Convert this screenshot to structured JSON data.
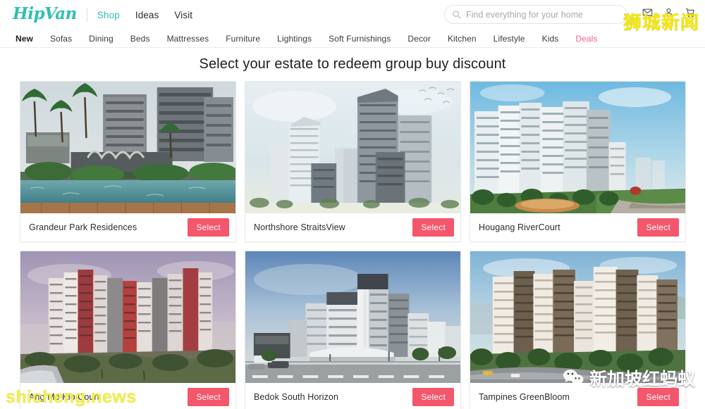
{
  "header": {
    "brand": "HipVan",
    "primary_nav": [
      {
        "label": "Shop",
        "active": true
      },
      {
        "label": "Ideas",
        "active": false
      },
      {
        "label": "Visit",
        "active": false
      }
    ],
    "search": {
      "placeholder": "Find everything for your home",
      "value": "",
      "icon": "search-icon"
    },
    "icons": [
      {
        "name": "mail-icon"
      },
      {
        "name": "user-icon"
      },
      {
        "name": "cart-icon"
      }
    ],
    "brand_color": "#2fbfb0"
  },
  "category_nav": {
    "items": [
      {
        "label": "New",
        "highlight": false
      },
      {
        "label": "Sofas",
        "highlight": false
      },
      {
        "label": "Dining",
        "highlight": false
      },
      {
        "label": "Beds",
        "highlight": false
      },
      {
        "label": "Mattresses",
        "highlight": false
      },
      {
        "label": "Furniture",
        "highlight": false
      },
      {
        "label": "Lightings",
        "highlight": false
      },
      {
        "label": "Soft Furnishings",
        "highlight": false
      },
      {
        "label": "Decor",
        "highlight": false
      },
      {
        "label": "Kitchen",
        "highlight": false
      },
      {
        "label": "Lifestyle",
        "highlight": false
      },
      {
        "label": "Kids",
        "highlight": false
      },
      {
        "label": "Deals",
        "highlight": true
      }
    ],
    "deals_color": "#f4608a"
  },
  "main": {
    "title": "Select your estate to redeem group buy discount",
    "select_label": "Select",
    "select_button_color": "#f4566b",
    "estates": [
      {
        "name": "Grandeur Park Residences",
        "select_label": "Select"
      },
      {
        "name": "Northshore StraitsView",
        "select_label": "Select"
      },
      {
        "name": "Hougang RiverCourt",
        "select_label": "Select"
      },
      {
        "name": "Ang Mo Kio Court",
        "select_label": "Select"
      },
      {
        "name": "Bedok South Horizon",
        "select_label": "Select"
      },
      {
        "name": "Tampines GreenBloom",
        "select_label": "Select"
      }
    ]
  },
  "watermarks": {
    "top_right_cn": "狮城新闻",
    "bottom_left": "shicheng.news",
    "bottom_right_cn": "新加坡红蚂蚁",
    "yellow": "#f5e90a"
  }
}
